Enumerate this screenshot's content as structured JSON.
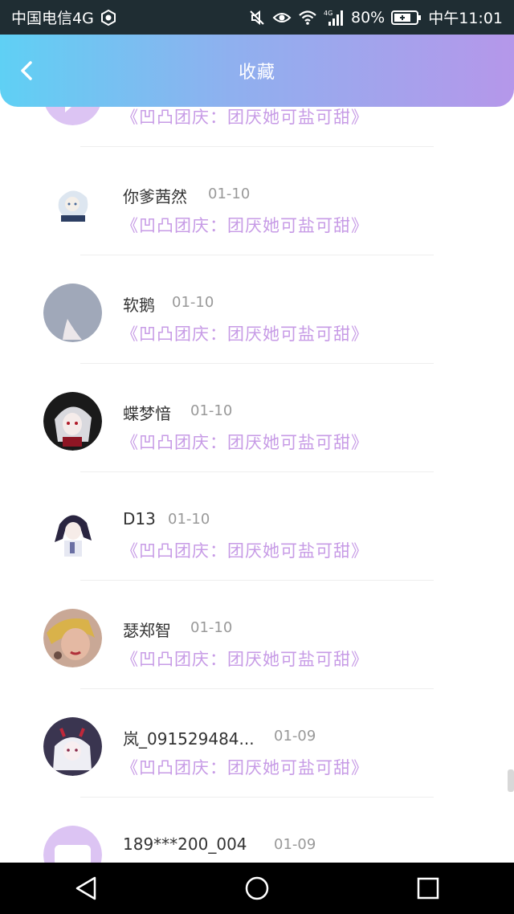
{
  "status_bar": {
    "carrier": "中国电信4G",
    "battery": "80%",
    "time": "中午11:01",
    "network": "4G",
    "icons": [
      "wechat-icon",
      "mute-icon",
      "eye-icon",
      "wifi-icon",
      "signal-icon",
      "battery-icon"
    ]
  },
  "header": {
    "title": "收藏",
    "back_icon": "chevron-left-icon",
    "gradient_colors": [
      "#5fd0f4",
      "#b597ea"
    ]
  },
  "list": {
    "items": [
      {
        "name": "",
        "date": "",
        "title": "《凹凸团庆：团厌她可盐可甜》",
        "avatar": "chat-bubble-avatar",
        "partial": true
      },
      {
        "name": "你爹茜然",
        "date": "01-10",
        "title": "《凹凸团庆：团厌她可盐可甜》",
        "avatar": "anime-girl-white-avatar"
      },
      {
        "name": "软鹅",
        "date": "01-10",
        "title": "《凹凸团庆：团厌她可盐可甜》",
        "avatar": "moon-avatar"
      },
      {
        "name": "蝶梦愔",
        "date": "01-10",
        "title": "《凹凸团庆：团厌她可盐可甜》",
        "avatar": "anime-girl-silver-avatar"
      },
      {
        "name": "D13",
        "date": "01-10",
        "title": "《凹凸团庆：团厌她可盐可甜》",
        "avatar": "anime-girl-ponytail-avatar"
      },
      {
        "name": "瑟郑智",
        "date": "01-10",
        "title": "《凹凸团庆：团厌她可盐可甜》",
        "avatar": "woman-photo-avatar"
      },
      {
        "name": "岚_091529484...",
        "date": "01-09",
        "title": "《凹凸团庆：团厌她可盐可甜》",
        "avatar": "anime-girl-horns-avatar"
      },
      {
        "name": "189***200_004",
        "date": "01-09",
        "title": "",
        "avatar": "chat-bubble-avatar",
        "partial": true
      }
    ],
    "title_color": "#c79be6"
  },
  "nav_bar": {
    "buttons": [
      "back-triangle-icon",
      "home-circle-icon",
      "recents-square-icon"
    ]
  }
}
